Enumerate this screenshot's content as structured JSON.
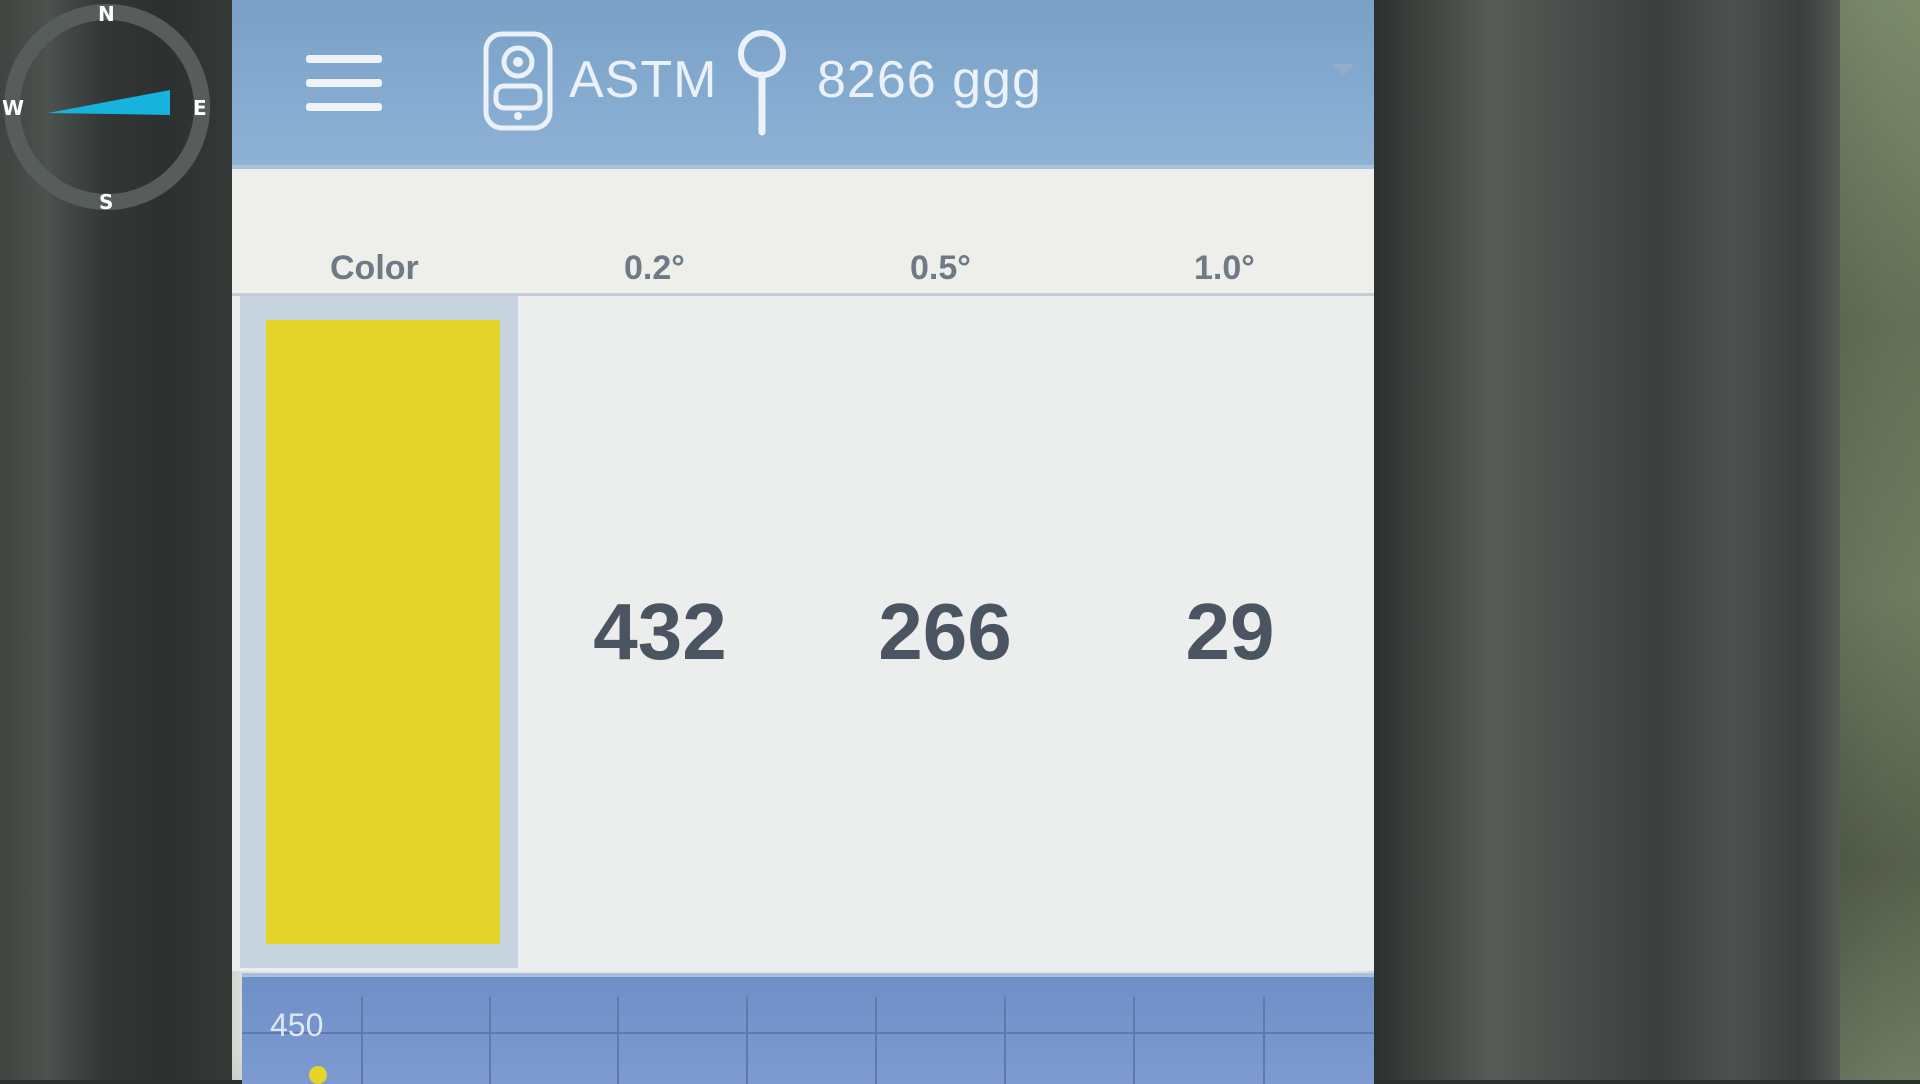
{
  "compass": {
    "north": "N",
    "east": "E",
    "south": "S",
    "west": "W"
  },
  "header": {
    "menu_icon": "hamburger-menu-icon",
    "device_icon": "instrument-icon",
    "standard": "ASTM",
    "location_icon": "map-pin-icon",
    "location": "8266 ggg"
  },
  "table": {
    "columns": [
      "Color",
      "0.2°",
      "0.5°",
      "1.0°"
    ],
    "row": {
      "color_hex": "#e5d42b",
      "values": [
        "432",
        "266",
        "29"
      ]
    }
  },
  "graph": {
    "y_label": "450"
  }
}
